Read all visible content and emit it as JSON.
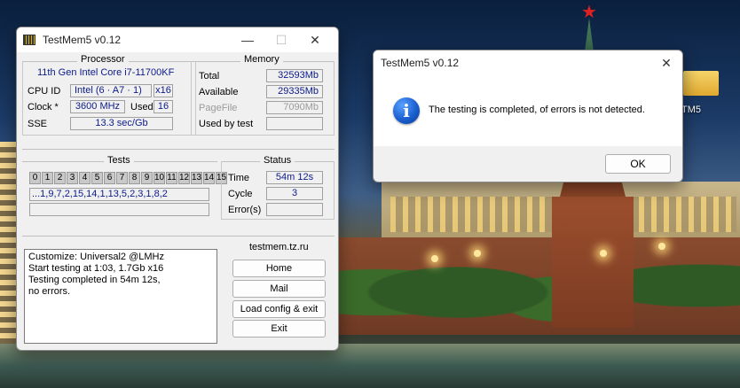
{
  "desktop": {
    "icon_label": "TM5"
  },
  "main_window": {
    "title": "TestMem5 v0.12",
    "processor": {
      "title": "Processor",
      "name": "11th Gen Intel Core i7-11700KF",
      "cpu_id_label": "CPU ID",
      "cpu_id_value": "Intel (6 · A7 · 1)",
      "threads": "x16",
      "clock_label": "Clock *",
      "clock_value": "3600 MHz",
      "used_label": "Used",
      "used_value": "16",
      "sse_label": "SSE",
      "sse_value": "13.3 sec/Gb"
    },
    "memory": {
      "title": "Memory",
      "total_label": "Total",
      "total_value": "32593Mb",
      "available_label": "Available",
      "available_value": "29335Mb",
      "pagefile_label": "PageFile",
      "pagefile_value": "7090Mb",
      "used_by_test_label": "Used by test",
      "used_by_test_value": ""
    },
    "tests": {
      "title": "Tests",
      "numbers": [
        "0",
        "1",
        "2",
        "3",
        "4",
        "5",
        "6",
        "7",
        "8",
        "9",
        "10",
        "11",
        "12",
        "13",
        "14",
        "15"
      ],
      "sequence": "...1,9,7,2,15,14,1,13,5,2,3,1,8,2",
      "progress": ""
    },
    "status": {
      "title": "Status",
      "time_label": "Time",
      "time_value": "54m 12s",
      "cycle_label": "Cycle",
      "cycle_value": "3",
      "errors_label": "Error(s)",
      "errors_value": ""
    },
    "log": [
      "Customize: Universal2 @LMHz",
      "Start testing at 1:03, 1.7Gb x16",
      "Testing completed in 54m 12s,",
      "no errors."
    ],
    "links": {
      "title": "testmem.tz.ru",
      "home": "Home",
      "mail": "Mail",
      "load": "Load config & exit",
      "exit": "Exit"
    }
  },
  "dialog": {
    "title": "TestMem5 v0.12",
    "message": "The testing is completed, of errors is not detected.",
    "ok": "OK"
  },
  "colors": {
    "value_text": "#0b1a8a",
    "window_bg": "#f0f0f0",
    "info_icon": "#1a5fd0"
  }
}
